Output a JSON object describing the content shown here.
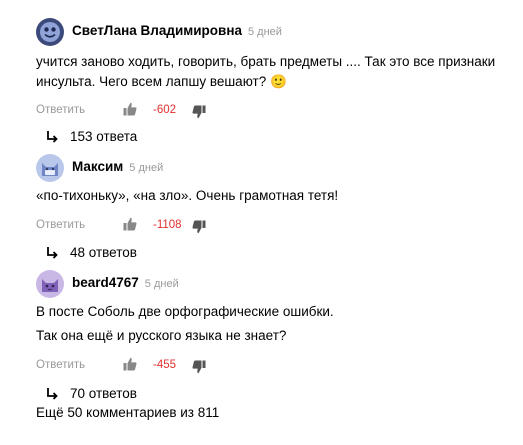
{
  "comments": [
    {
      "author": "СветЛана Владимировна",
      "time": "5 дней",
      "lines": [
        "учится заново ходить, говорить, брать предметы .... Так это все признаки",
        "инсульта. Чего всем лапшу вешают? 🙂"
      ],
      "reply_label": "Ответить",
      "score": "-602",
      "replies": "153 ответа",
      "avatar_icon": "smiley-avatar-icon"
    },
    {
      "author": "Максим",
      "time": "5 дней",
      "lines": [
        "«по-тихоньку», «на зло». Очень грамотная тетя!"
      ],
      "reply_label": "Ответить",
      "score": "-1108",
      "replies": "48 ответов",
      "avatar_icon": "cat-avatar-icon"
    },
    {
      "author": "beard4767",
      "time": "5 дней",
      "lines": [
        "В посте Соболь две орфографические ошибки.",
        "Так она ещё и русского языка не знает?"
      ],
      "reply_label": "Ответить",
      "score": "-455",
      "replies": "70 ответов",
      "avatar_icon": "cat-avatar-icon"
    }
  ],
  "more_comments": "Ещё 50 комментариев из 811",
  "colors": {
    "score_negative": "#e03030",
    "muted": "#999999",
    "avatar_blue": "#b8c7ea",
    "avatar_purple": "#c9b7e6"
  }
}
